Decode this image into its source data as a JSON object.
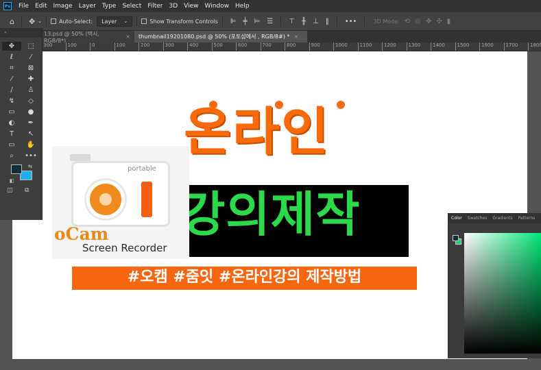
{
  "app": {
    "logo": "Ps"
  },
  "menu": [
    "File",
    "Edit",
    "Image",
    "Layer",
    "Type",
    "Select",
    "Filter",
    "3D",
    "View",
    "Window",
    "Help"
  ],
  "options": {
    "auto_select": "Auto-Select:",
    "layer_select": "Layer",
    "show_transform": "Show Transform Controls",
    "more": "•••",
    "three_d_mode": "3D Mode:"
  },
  "tabs": [
    {
      "label": "13.psd @ 50% (택시, RGB/8*)",
      "close": "×"
    },
    {
      "label": "thumbnail19201080.psd @ 50% (포토샵에서     , RGB/8#) *",
      "close": "×"
    }
  ],
  "ruler": [
    "300",
    "100",
    "0",
    "100",
    "200",
    "300",
    "400",
    "500",
    "600",
    "700",
    "800",
    "900",
    "1000",
    "1100",
    "1200",
    "1300",
    "1400",
    "1500",
    "1600",
    "1700",
    "1800"
  ],
  "canvas": {
    "title_line1": "온라인",
    "title_line2": "강의제작",
    "ocam_portable": "portable",
    "ocam_word": "oCam",
    "ocam_sub": "Screen Recorder",
    "hashtags": "#오캠 #줌잇 #온라인강의 제작방법"
  },
  "color_panel": {
    "tabs": [
      "Color",
      "Swatches",
      "Gradients",
      "Patterns"
    ],
    "fg_color": "#0d2e3a",
    "bg_color": "#1ecf6e"
  },
  "colors": {
    "accent_orange": "#fb6a0a",
    "accent_green": "#2bd94a"
  }
}
